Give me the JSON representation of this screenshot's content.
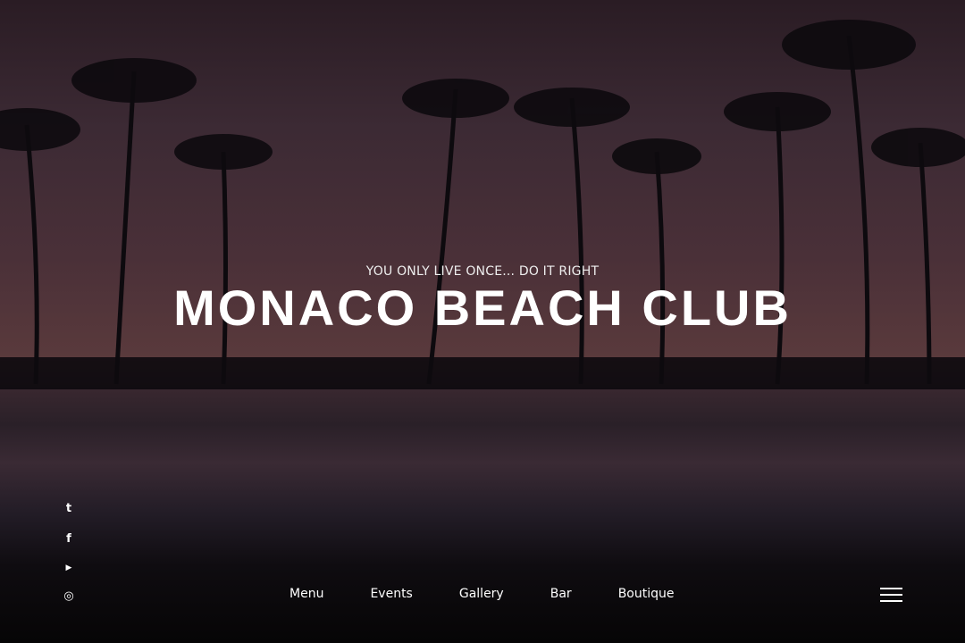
{
  "hero": {
    "tagline": "YOU ONLY LIVE ONCE... DO IT RIGHT",
    "title": "MONACO BEACH CLUB"
  },
  "social": [
    {
      "icon": "twitter-icon",
      "glyph": "t"
    },
    {
      "icon": "facebook-icon",
      "glyph": "f"
    },
    {
      "icon": "youtube-icon",
      "glyph": "▶"
    },
    {
      "icon": "instagram-icon",
      "glyph": "◎"
    }
  ],
  "nav": [
    "Menu",
    "Events",
    "Gallery",
    "Bar",
    "Boutique"
  ]
}
